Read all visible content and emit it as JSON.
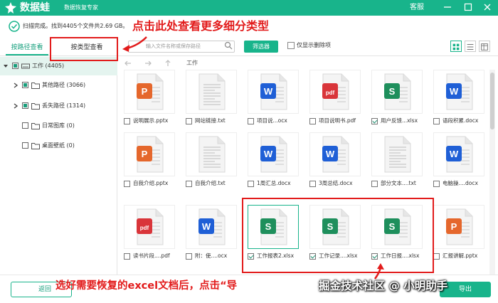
{
  "app": {
    "name": "数据蛙",
    "subtitle": "数据恢复专家",
    "service": "客服"
  },
  "status": {
    "scan_text": "扫描完成。找到4405个文件共2.69 GB。"
  },
  "tabs": {
    "by_path": "按路径查看",
    "by_type": "按类型查看"
  },
  "toolbar": {
    "search_placeholder": "输入文件名称或保存路径",
    "filter": "筛选器",
    "show_deleted": "仅显示删除项"
  },
  "tree": [
    {
      "label": "工作 (4405)"
    },
    {
      "label": "其他路径 (3066)"
    },
    {
      "label": "丢失路径 (1314)"
    },
    {
      "label": "日常图库 (0)"
    },
    {
      "label": "桌面壁纸 (0)"
    }
  ],
  "nav": {
    "path": "工作"
  },
  "files": [
    {
      "name": "说明展示.pptx",
      "type": "pptx",
      "checked": false
    },
    {
      "name": "网站链接.txt",
      "type": "txt",
      "checked": false
    },
    {
      "name": "项目说...ocx",
      "type": "docx",
      "checked": false
    },
    {
      "name": "项目说明书.pdf",
      "type": "pdf",
      "checked": false
    },
    {
      "name": "用户反馈...xlsx",
      "type": "xlsx",
      "checked": true
    },
    {
      "name": "语段积累.docx",
      "type": "docx",
      "checked": false
    },
    {
      "name": "自我介绍.pptx",
      "type": "pptx",
      "checked": false
    },
    {
      "name": "自我介绍.txt",
      "type": "txt",
      "checked": false
    },
    {
      "name": "1周汇总.docx",
      "type": "docx",
      "checked": false
    },
    {
      "name": "3周总结.docx",
      "type": "docx",
      "checked": false
    },
    {
      "name": "部分文本....txt",
      "type": "txt",
      "checked": false
    },
    {
      "name": "电脑操....docx",
      "type": "docx",
      "checked": false
    },
    {
      "name": "读书片段....pdf",
      "type": "pdf",
      "checked": false
    },
    {
      "name": "附：使....ocx",
      "type": "docx",
      "checked": false
    },
    {
      "name": "工作报表2.xlsx",
      "type": "xlsx",
      "checked": true
    },
    {
      "name": "工作记录....xlsx",
      "type": "xlsx",
      "checked": true
    },
    {
      "name": "工作日报....xlsx",
      "type": "xlsx",
      "checked": true
    },
    {
      "name": "汇报讲解.pptx",
      "type": "pptx",
      "checked": false
    }
  ],
  "bottom": {
    "back": "返回",
    "recover": "导出"
  },
  "annotations": {
    "top_hint": "点击此处查看更多细分类型",
    "bottom_hint": "选好需要恢复的excel文档后，点击“导",
    "watermark": "掘金技术社区 @ 小明助手"
  },
  "colors": {
    "brand": "#18b48b",
    "annotation": "#e21b1b",
    "word": "#1f5fd6",
    "excel": "#1e8f5c",
    "ppt": "#e5672c",
    "pdf": "#d9353a"
  }
}
